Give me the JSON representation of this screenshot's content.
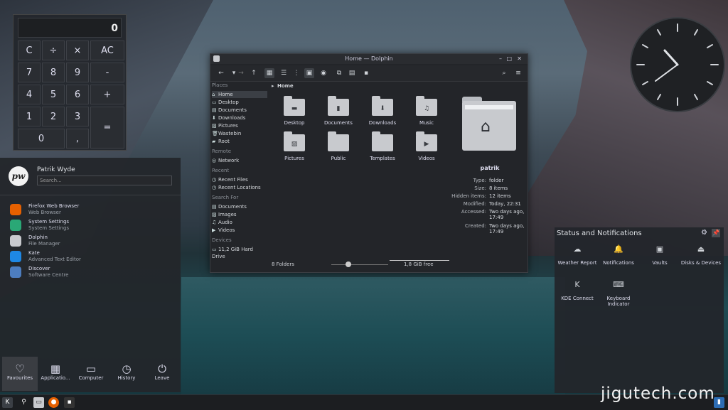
{
  "calculator": {
    "display": "0",
    "keys": [
      "C",
      "÷",
      "×",
      "AC",
      "7",
      "8",
      "9",
      "-",
      "4",
      "5",
      "6",
      "+",
      "1",
      "2",
      "3",
      "=",
      "0",
      ","
    ]
  },
  "dolphin": {
    "title": "Home — Dolphin",
    "breadcrumb": "Home",
    "places_header": "Places",
    "places": [
      "Home",
      "Desktop",
      "Documents",
      "Downloads",
      "Pictures",
      "Wastebin",
      "Root"
    ],
    "remote_header": "Remote",
    "remote": [
      "Network"
    ],
    "recent_header": "Recent",
    "recent": [
      "Recent Files",
      "Recent Locations"
    ],
    "search_header": "Search For",
    "search": [
      "Documents",
      "Images",
      "Audio",
      "Videos"
    ],
    "devices_header": "Devices",
    "devices": [
      "11,2 GiB Hard Drive"
    ],
    "folders": [
      "Desktop",
      "Documents",
      "Downloads",
      "Music",
      "Pictures",
      "Public",
      "Templates",
      "Videos"
    ],
    "info": {
      "name": "patrik",
      "rows": [
        {
          "k": "Type:",
          "v": "folder"
        },
        {
          "k": "Size:",
          "v": "8 items"
        },
        {
          "k": "Hidden items:",
          "v": "12 items"
        },
        {
          "k": "Modified:",
          "v": "Today, 22:31"
        },
        {
          "k": "Accessed:",
          "v": "Two days ago, 17:49"
        },
        {
          "k": "Created:",
          "v": "Two days ago, 17:49"
        }
      ]
    },
    "status_left": "8 Folders",
    "status_right": "1,8 GiB free",
    "zoom_level": 0.3
  },
  "launcher": {
    "user": "Patrik Wyde",
    "avatar": "pw",
    "search_placeholder": "Search...",
    "apps": [
      {
        "name": "Firefox Web Browser",
        "desc": "Web Browser",
        "color": "#e66000"
      },
      {
        "name": "System Settings",
        "desc": "System Settings",
        "color": "#2aa876"
      },
      {
        "name": "Dolphin",
        "desc": "File Manager",
        "color": "#c8cace"
      },
      {
        "name": "Kate",
        "desc": "Advanced Text Editor",
        "color": "#1e88e5"
      },
      {
        "name": "Discover",
        "desc": "Software Centre",
        "color": "#4d7dbf"
      }
    ],
    "tabs": [
      "Favourites",
      "Applicatio...",
      "Computer",
      "History",
      "Leave"
    ]
  },
  "status_panel": {
    "title": "Status and Notifications",
    "items": [
      "Weather Report",
      "Notifications",
      "Vaults",
      "Disks & Devices",
      "KDE Connect",
      "Keyboard Indicator"
    ]
  },
  "watermark": "jigutech.com"
}
